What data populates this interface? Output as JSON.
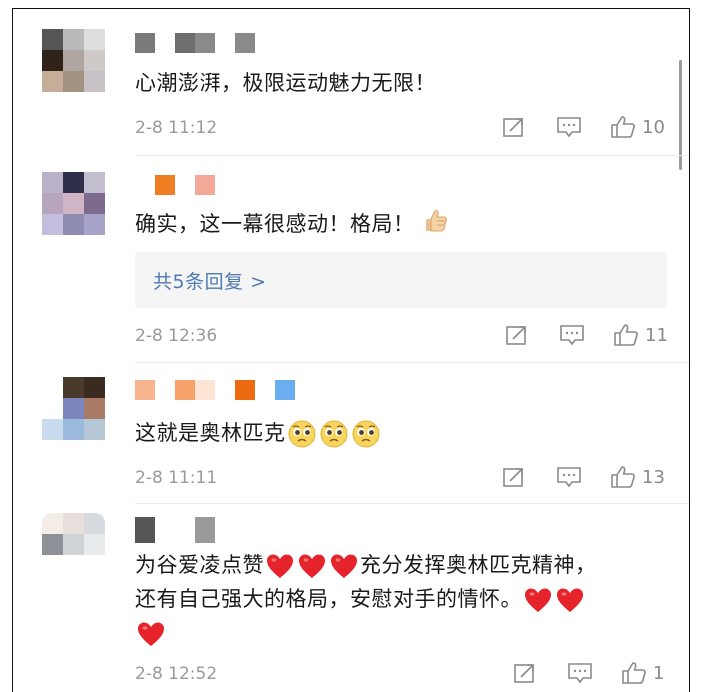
{
  "comments": [
    {
      "text": "心潮澎湃，极限运动魅力无限！",
      "time": "2-8 11:12",
      "likes": "10",
      "avatar_colors": [
        "#555555",
        "#b9b9b9",
        "#dedede",
        "#2f2219",
        "#b0a6a1",
        "#cfc9c8",
        "#c4ae98",
        "#a39280",
        "#c8c2c7"
      ],
      "name_colors": [
        "#7a7a7a",
        "#ffffff",
        "#6e6e6e",
        "#8a8a8a",
        "#ffffff",
        "#8a8a8a"
      ]
    },
    {
      "text": "确实，这一幕很感动！格局！",
      "emoji": "thumbs-up",
      "time": "2-8 12:36",
      "likes": "11",
      "reply_label": "共5条回复 >",
      "avatar_colors": [
        "#b9b2c9",
        "#302f4a",
        "#c3bdd0",
        "#b7a5be",
        "#cfb5c6",
        "#7e6a8d",
        "#c3bedd",
        "#8f8cb2",
        "#a7a3c8"
      ],
      "name_colors": [
        "#ffffff",
        "#ef7d22",
        "#ffffff",
        "#f4a898"
      ]
    },
    {
      "text": "这就是奥林匹克",
      "emoji": "pleading-face",
      "time": "2-8 11:11",
      "likes": "13",
      "avatar_colors": [
        "#ffffff",
        "#4a3a2c",
        "#3a2a1f",
        "#ffffff",
        "#7b86bc",
        "#a97a66",
        "#c9dcef",
        "#9cb9de",
        "#b6c7d8"
      ],
      "name_colors": [
        "#f6b38d",
        "#ffffff",
        "#f6a26a",
        "#fde5d6",
        "#ffffff",
        "#ee6a12",
        "#ffffff",
        "#6baef0"
      ]
    },
    {
      "text_line1": "为谷爱凌点赞",
      "text_line1b": "充分发挥奥林匹克精神，",
      "text_line2": "还有自己强大的格局，安慰对手的情怀。",
      "emoji": "red-heart",
      "time": "2-8 12:52",
      "likes": "1",
      "avatar_colors": [
        "#f4ece6",
        "#e6dfdc",
        "#d9dadf",
        "#8d9094",
        "#d2d3d6",
        "#e9eaec",
        "#ffffff",
        "#ffffff",
        "#ffffff"
      ],
      "name_colors": [
        "#555555",
        "#ffffff",
        "#ffffff",
        "#9a9a9a"
      ]
    }
  ]
}
